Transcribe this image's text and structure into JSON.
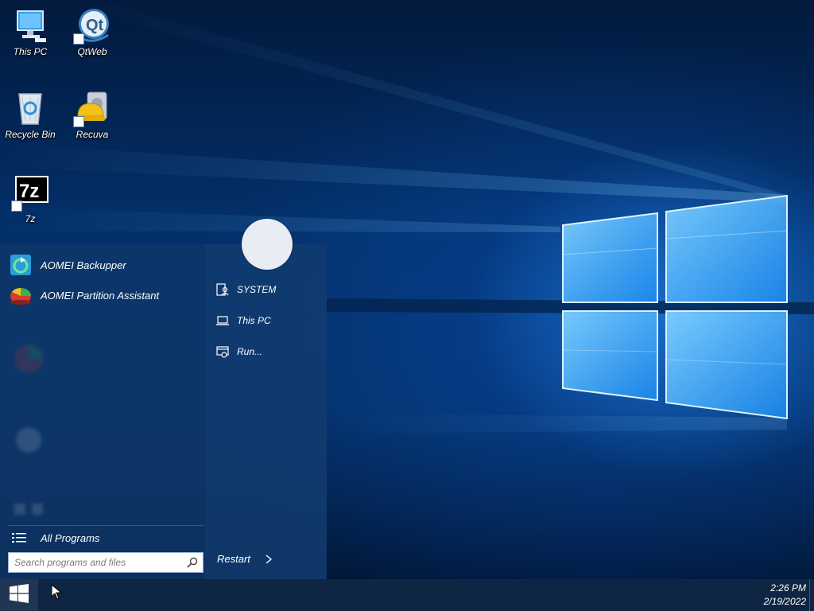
{
  "desktop": {
    "icons": [
      {
        "label": "This PC",
        "icon": "computer-icon"
      },
      {
        "label": "QtWeb",
        "icon": "qtweb-icon"
      },
      {
        "label": "Recycle Bin",
        "icon": "recycle-bin-icon"
      },
      {
        "label": "Recuva",
        "icon": "recuva-icon"
      },
      {
        "label": "7z",
        "icon": "7zip-icon"
      }
    ]
  },
  "start_menu": {
    "apps": [
      {
        "label": "AOMEI Backupper",
        "icon": "aomei-backupper-icon"
      },
      {
        "label": "AOMEI Partition Assistant",
        "icon": "aomei-partition-assistant-icon"
      }
    ],
    "all_programs_label": "All Programs",
    "search_placeholder": "Search programs and files",
    "right_items": [
      {
        "label": "SYSTEM",
        "icon": "user-folder-icon"
      },
      {
        "label": "This PC",
        "icon": "laptop-icon"
      },
      {
        "label": "Run...",
        "icon": "run-icon"
      }
    ],
    "restart_label": "Restart"
  },
  "taskbar": {
    "time": "2:26 PM",
    "date": "2/19/2022"
  },
  "colors": {
    "wallpaper_dark": "#021a3d",
    "wallpaper_glow": "#2896ff",
    "start_menu_bg": "#103869",
    "taskbar_bg": "#041c3c"
  }
}
